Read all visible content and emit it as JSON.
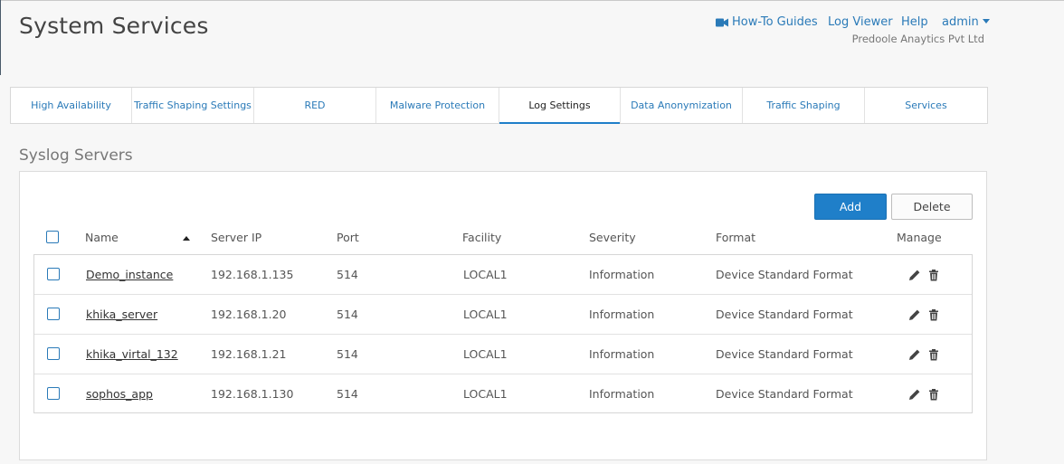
{
  "header": {
    "title": "System Services",
    "links": {
      "howto": "How-To Guides",
      "logviewer": "Log Viewer",
      "help": "Help",
      "user": "admin"
    },
    "company": "Predoole Anaytics Pvt Ltd",
    "accent_color": "#2a7ab8"
  },
  "tabs": [
    {
      "label": "High Availability",
      "active": false
    },
    {
      "label": "Traffic Shaping Settings",
      "active": false
    },
    {
      "label": "RED",
      "active": false
    },
    {
      "label": "Malware Protection",
      "active": false
    },
    {
      "label": "Log Settings",
      "active": true
    },
    {
      "label": "Data Anonymization",
      "active": false
    },
    {
      "label": "Traffic Shaping",
      "active": false
    },
    {
      "label": "Services",
      "active": false
    }
  ],
  "section": {
    "title": "Syslog Servers",
    "add_label": "Add",
    "delete_label": "Delete"
  },
  "table": {
    "columns": {
      "name": "Name",
      "server_ip": "Server IP",
      "port": "Port",
      "facility": "Facility",
      "severity": "Severity",
      "format": "Format",
      "manage": "Manage"
    },
    "sort": {
      "column": "Name",
      "direction": "ascending"
    },
    "rows": [
      {
        "name": "Demo_instance",
        "server_ip": "192.168.1.135",
        "port": "514",
        "facility": "LOCAL1",
        "severity": "Information",
        "format": "Device Standard Format"
      },
      {
        "name": "khika_server",
        "server_ip": "192.168.1.20",
        "port": "514",
        "facility": "LOCAL1",
        "severity": "Information",
        "format": "Device Standard Format"
      },
      {
        "name": "khika_virtal_132",
        "server_ip": "192.168.1.21",
        "port": "514",
        "facility": "LOCAL1",
        "severity": "Information",
        "format": "Device Standard Format"
      },
      {
        "name": "sophos_app",
        "server_ip": "192.168.1.130",
        "port": "514",
        "facility": "LOCAL1",
        "severity": "Information",
        "format": "Device Standard Format"
      }
    ]
  },
  "icons": {
    "edit": "pencil-icon",
    "delete": "trash-icon",
    "howto": "video-camera-icon"
  },
  "colors": {
    "primary_button": "#1f7fc9",
    "active_tab_underline": "#1f7fc9"
  }
}
